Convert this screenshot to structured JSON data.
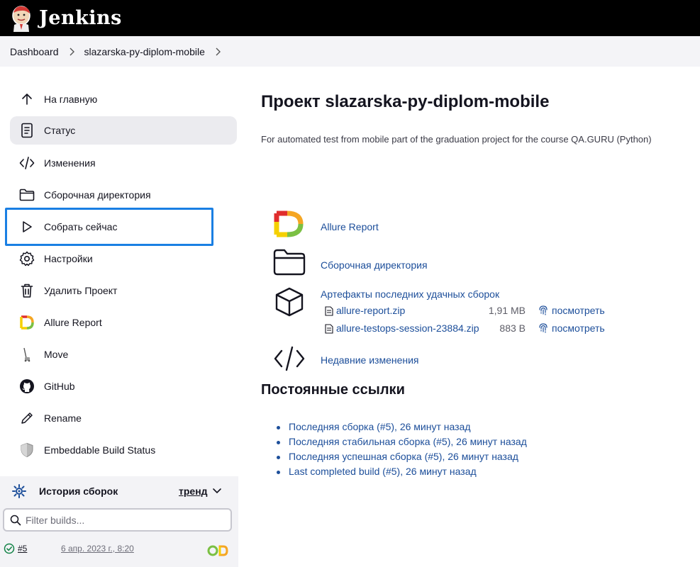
{
  "header": {
    "brand": "Jenkins"
  },
  "breadcrumb": {
    "items": [
      "Dashboard",
      "slazarska-py-diplom-mobile"
    ]
  },
  "sidebar": {
    "items": [
      {
        "label": "На главную",
        "icon": "arrow-up-icon"
      },
      {
        "label": "Статус",
        "icon": "document-icon",
        "active": true
      },
      {
        "label": "Изменения",
        "icon": "code-icon"
      },
      {
        "label": "Сборочная директория",
        "icon": "folder-icon"
      },
      {
        "label": "Собрать сейчас",
        "icon": "play-icon"
      },
      {
        "label": "Настройки",
        "icon": "gear-icon"
      },
      {
        "label": "Удалить Проект",
        "icon": "trash-icon"
      },
      {
        "label": "Allure Report",
        "icon": "allure-icon"
      },
      {
        "label": "Move",
        "icon": "move-icon"
      },
      {
        "label": "GitHub",
        "icon": "github-icon"
      },
      {
        "label": "Rename",
        "icon": "pencil-icon"
      },
      {
        "label": "Embeddable Build Status",
        "icon": "shield-icon"
      }
    ]
  },
  "build_history": {
    "title": "История сборок",
    "trend_label": "тренд",
    "filter_placeholder": "Filter builds...",
    "builds": [
      {
        "number": "#5",
        "date": "6 апр. 2023 г., 8:20",
        "status": "success"
      }
    ]
  },
  "main": {
    "title": "Проект slazarska-py-diplom-mobile",
    "description": "For automated test from mobile part of the graduation project for the course QA.GURU (Python)",
    "links": {
      "allure": "Allure Report",
      "workspace": "Сборочная директория",
      "artifacts": "Артефакты последних удачных сборок",
      "changes": "Недавние изменения"
    },
    "artifacts": [
      {
        "name": "allure-report.zip",
        "size": "1,91 MB",
        "view": "посмотреть"
      },
      {
        "name": "allure-testops-session-23884.zip",
        "size": "883 B",
        "view": "посмотреть"
      }
    ],
    "permalinks_title": "Постоянные ссылки",
    "permalinks": [
      "Последняя сборка (#5), 26 минут назад",
      "Последняя стабильная сборка (#5), 26 минут назад",
      "Последняя успешная сборка (#5), 26 минут назад",
      "Last completed build (#5), 26 минут назад"
    ]
  },
  "colors": {
    "header_bg": "#000000",
    "link": "#1c4e9a",
    "highlight": "#1a7fe3",
    "active_bg": "#ebebef"
  }
}
